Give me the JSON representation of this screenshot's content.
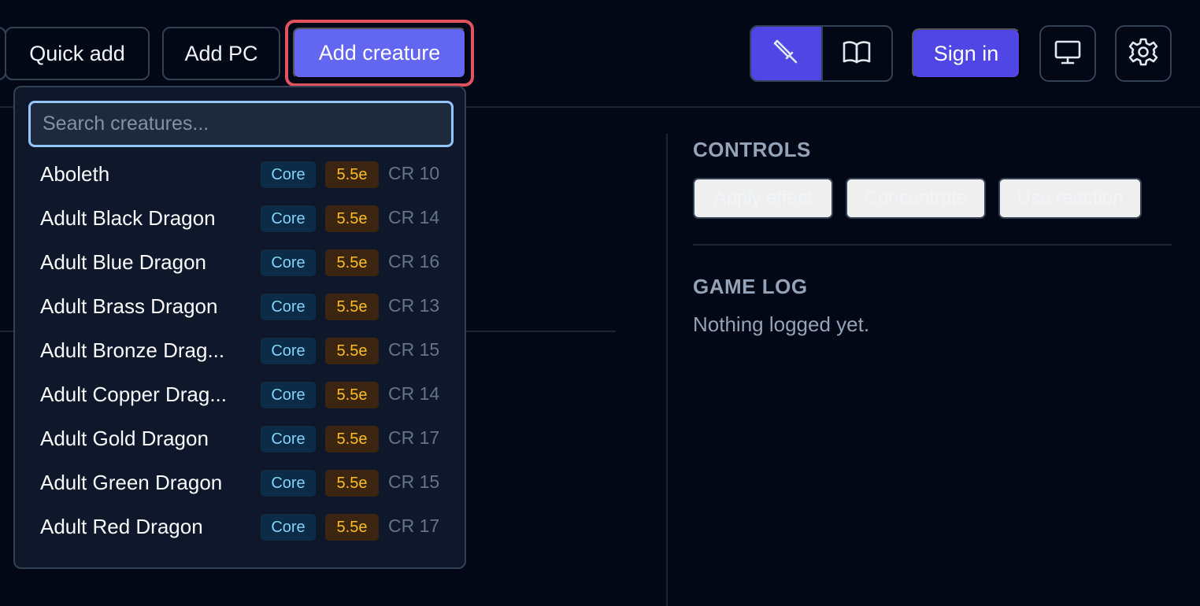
{
  "toolbar": {
    "quick_add": "Quick add",
    "add_pc": "Add PC",
    "add_creature": "Add creature",
    "sign_in": "Sign in",
    "mode_toggle": [
      {
        "icon": "sword-icon",
        "active": true
      },
      {
        "icon": "book-open-icon",
        "active": false
      }
    ],
    "icons": [
      "monitor-icon",
      "gear-icon"
    ]
  },
  "dropdown": {
    "search_placeholder": "Search creatures...",
    "creatures": [
      {
        "name": "Aboleth",
        "source": "Core",
        "edition": "5.5e",
        "cr": "CR 10"
      },
      {
        "name": "Adult Black Dragon",
        "source": "Core",
        "edition": "5.5e",
        "cr": "CR 14"
      },
      {
        "name": "Adult Blue Dragon",
        "source": "Core",
        "edition": "5.5e",
        "cr": "CR 16"
      },
      {
        "name": "Adult Brass Dragon",
        "source": "Core",
        "edition": "5.5e",
        "cr": "CR 13"
      },
      {
        "name": "Adult Bronze Drag...",
        "source": "Core",
        "edition": "5.5e",
        "cr": "CR 15"
      },
      {
        "name": "Adult Copper Drag...",
        "source": "Core",
        "edition": "5.5e",
        "cr": "CR 14"
      },
      {
        "name": "Adult Gold Dragon",
        "source": "Core",
        "edition": "5.5e",
        "cr": "CR 17"
      },
      {
        "name": "Adult Green Dragon",
        "source": "Core",
        "edition": "5.5e",
        "cr": "CR 15"
      },
      {
        "name": "Adult Red Dragon",
        "source": "Core",
        "edition": "5.5e",
        "cr": "CR 17"
      }
    ]
  },
  "controls": {
    "title": "CONTROLS",
    "apply_effect": "Apply effect",
    "concentrate": "Concentrate",
    "use_reaction": "Use reaction"
  },
  "game_log": {
    "title": "GAME LOG",
    "empty_text": "Nothing logged yet."
  },
  "colors": {
    "background": "#030816",
    "accent": "#6366f1",
    "focus_ring": "#e0535f",
    "core_badge": "#7dd3fc",
    "edition_badge": "#fbbf24"
  }
}
